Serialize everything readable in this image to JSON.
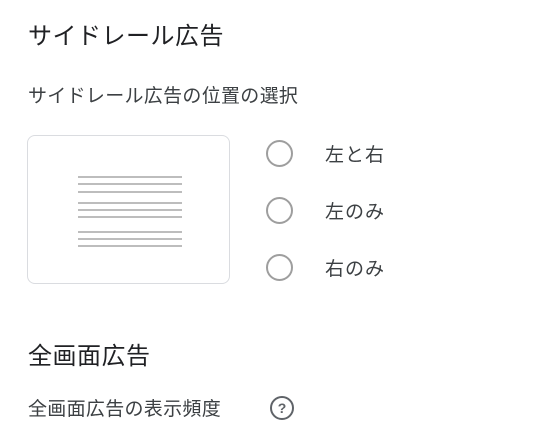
{
  "sidebar_ad": {
    "title": "サイドレール広告",
    "position_label": "サイドレール広告の位置の選択",
    "options": [
      {
        "label": "左と右",
        "selected": false
      },
      {
        "label": "左のみ",
        "selected": false
      },
      {
        "label": "右のみ",
        "selected": false
      }
    ]
  },
  "fullscreen_ad": {
    "title": "全画面広告",
    "frequency_label": "全画面広告の表示頻度",
    "help_icon": "help-circle-icon",
    "help_glyph": "?"
  },
  "colors": {
    "text": "#202124",
    "secondary_text": "#3c4043",
    "radio_border": "#9e9e9e",
    "preview_border": "#dadce0",
    "preview_lines": "#bdbdbd"
  }
}
